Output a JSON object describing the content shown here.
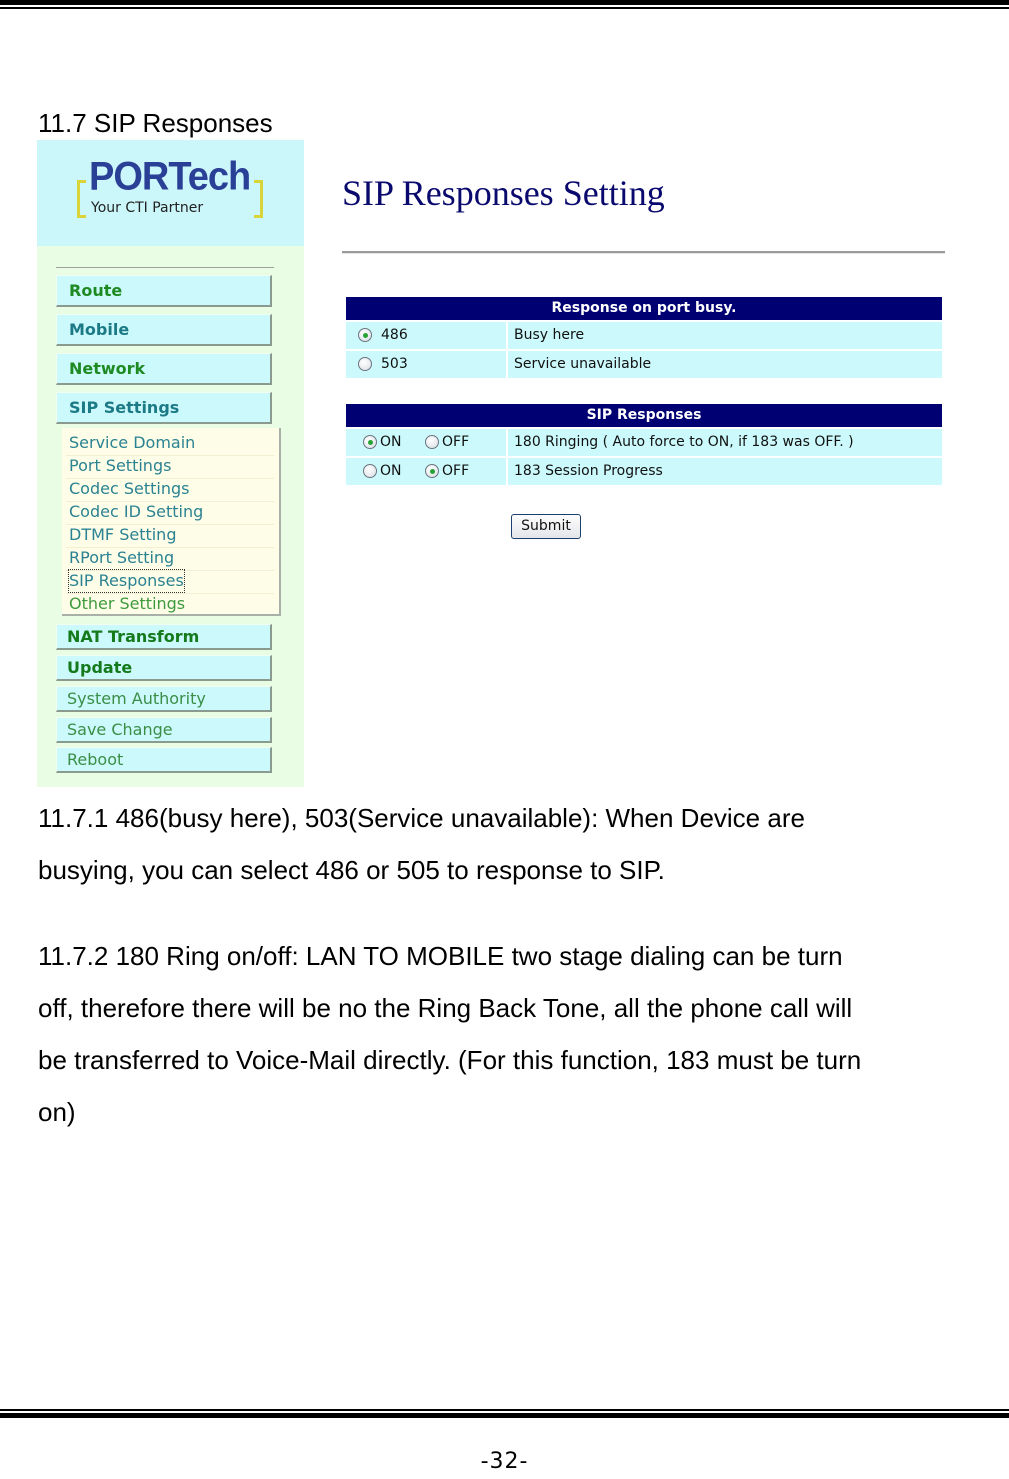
{
  "section_title": "11.7 SIP Responses",
  "screenshot": {
    "logo": {
      "brand": "PORTech",
      "tagline": "Your CTI Partner"
    },
    "nav": {
      "main_items": [
        {
          "label": "Route"
        },
        {
          "label": "Mobile"
        },
        {
          "label": "Network"
        },
        {
          "label": "SIP Settings"
        }
      ],
      "sip_submenu": [
        {
          "label": "Service Domain"
        },
        {
          "label": "Port Settings"
        },
        {
          "label": "Codec Settings"
        },
        {
          "label": "Codec ID Setting"
        },
        {
          "label": "DTMF Setting"
        },
        {
          "label": "RPort Setting"
        },
        {
          "label": "SIP Responses",
          "active": true
        },
        {
          "label": "Other Settings"
        }
      ],
      "lower_items": [
        {
          "label": "NAT Transform"
        },
        {
          "label": "Update"
        },
        {
          "label": "System Authority"
        },
        {
          "label": "Save Change"
        },
        {
          "label": "Reboot"
        }
      ]
    },
    "main": {
      "title": "SIP Responses Setting",
      "busy_table": {
        "header": "Response on port busy.",
        "rows": [
          {
            "code": "486",
            "description": "Busy here",
            "selected": true
          },
          {
            "code": "503",
            "description": "Service unavailable",
            "selected": false
          }
        ]
      },
      "sip_table": {
        "header": "SIP Responses",
        "on_label": "ON",
        "off_label": "OFF",
        "rows": [
          {
            "description": "180 Ringing ( Auto force to ON, if 183 was OFF. )",
            "value": "ON"
          },
          {
            "description": "183 Session Progress",
            "value": "OFF"
          }
        ]
      },
      "submit_label": "Submit"
    },
    "colors": {
      "table_header_bg": "#000072",
      "row_bg": "#ccf9fb",
      "sidebar_bg": "#e8fde4",
      "title_color": "#0a0a6e"
    }
  },
  "paragraphs": {
    "p1_line1": "11.7.1 486(busy here), 503(Service unavailable): When Device are",
    "p1_line2": "busying, you can select 486 or 505 to response to SIP.",
    "p2_line1": "11.7.2 180 Ring on/off: LAN TO MOBILE two stage dialing can be turn",
    "p2_line2": "off, therefore there will be no the Ring Back Tone, all the phone call will",
    "p2_line3": "be transferred to Voice-Mail directly. (For this function, 183 must be turn",
    "p2_line4": "on)"
  },
  "page_number": "-32-"
}
